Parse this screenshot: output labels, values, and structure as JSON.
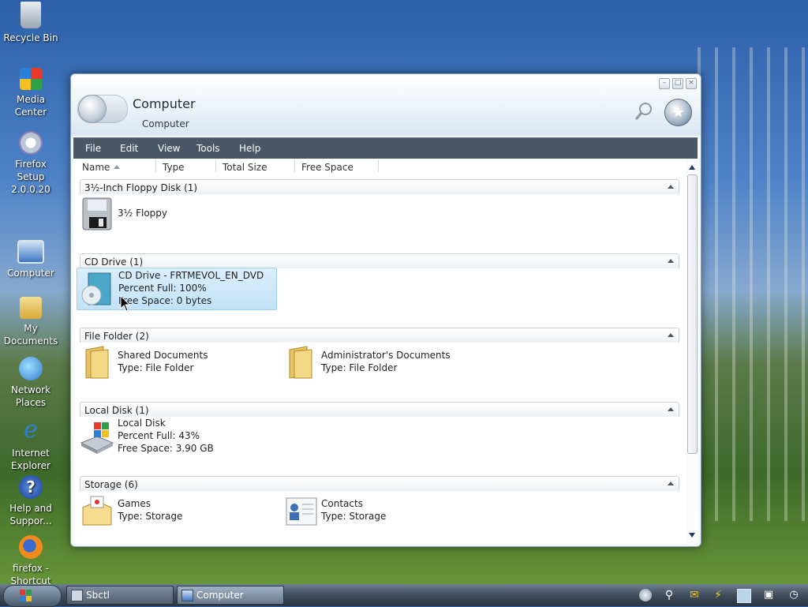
{
  "desktop": {
    "icons": [
      {
        "label": "Recycle Bin",
        "icon": "recycle-bin-icon"
      },
      {
        "label": "Media Center",
        "icon": "media-center-icon"
      },
      {
        "label": "Firefox Setup 2.0.0.20",
        "icon": "firefox-setup-icon"
      },
      {
        "label": "Computer",
        "icon": "computer-icon"
      },
      {
        "label": "My Documents",
        "icon": "my-documents-icon"
      },
      {
        "label": "Network Places",
        "icon": "network-places-icon"
      },
      {
        "label": "Internet Explorer",
        "icon": "internet-explorer-icon"
      },
      {
        "label": "Help and Suppor...",
        "icon": "help-icon"
      },
      {
        "label": "firefox - Shortcut",
        "icon": "firefox-icon"
      }
    ]
  },
  "window": {
    "title": "Computer",
    "breadcrumb": "Computer",
    "controls": {
      "minimize": "–",
      "maximize": "□",
      "close": "×"
    },
    "menu": [
      "File",
      "Edit",
      "View",
      "Tools",
      "Help"
    ],
    "columns": [
      "Name",
      "Type",
      "Total Size",
      "Free Space"
    ],
    "groups": [
      {
        "title": "3½-Inch Floppy Disk (1)",
        "items": [
          {
            "icon": "floppy-disk-icon",
            "lines": [
              "3½ Floppy"
            ]
          }
        ]
      },
      {
        "title": "CD Drive (1)",
        "items": [
          {
            "icon": "cd-drive-icon",
            "lines": [
              "CD Drive - FRTMEVOL_EN_DVD",
              "Percent Full: 100%",
              "Free Space: 0 bytes"
            ]
          }
        ]
      },
      {
        "title": "File Folder (2)",
        "items": [
          {
            "icon": "folder-icon",
            "lines": [
              "Shared Documents",
              "Type: File Folder"
            ]
          },
          {
            "icon": "folder-icon",
            "lines": [
              "Administrator's Documents",
              "Type: File Folder"
            ]
          }
        ]
      },
      {
        "title": "Local Disk (1)",
        "items": [
          {
            "icon": "local-disk-icon",
            "lines": [
              "Local Disk",
              "Percent Full: 43%",
              "Free Space: 3.90 GB"
            ]
          }
        ]
      },
      {
        "title": "Storage (6)",
        "items": [
          {
            "icon": "games-folder-icon",
            "lines": [
              "Games",
              "Type: Storage"
            ]
          },
          {
            "icon": "contacts-icon",
            "lines": [
              "Contacts",
              "Type: Storage"
            ]
          }
        ]
      }
    ]
  },
  "taskbar": {
    "buttons": [
      {
        "label": "Sbctl",
        "active": false
      },
      {
        "label": "Computer",
        "active": true
      }
    ]
  }
}
